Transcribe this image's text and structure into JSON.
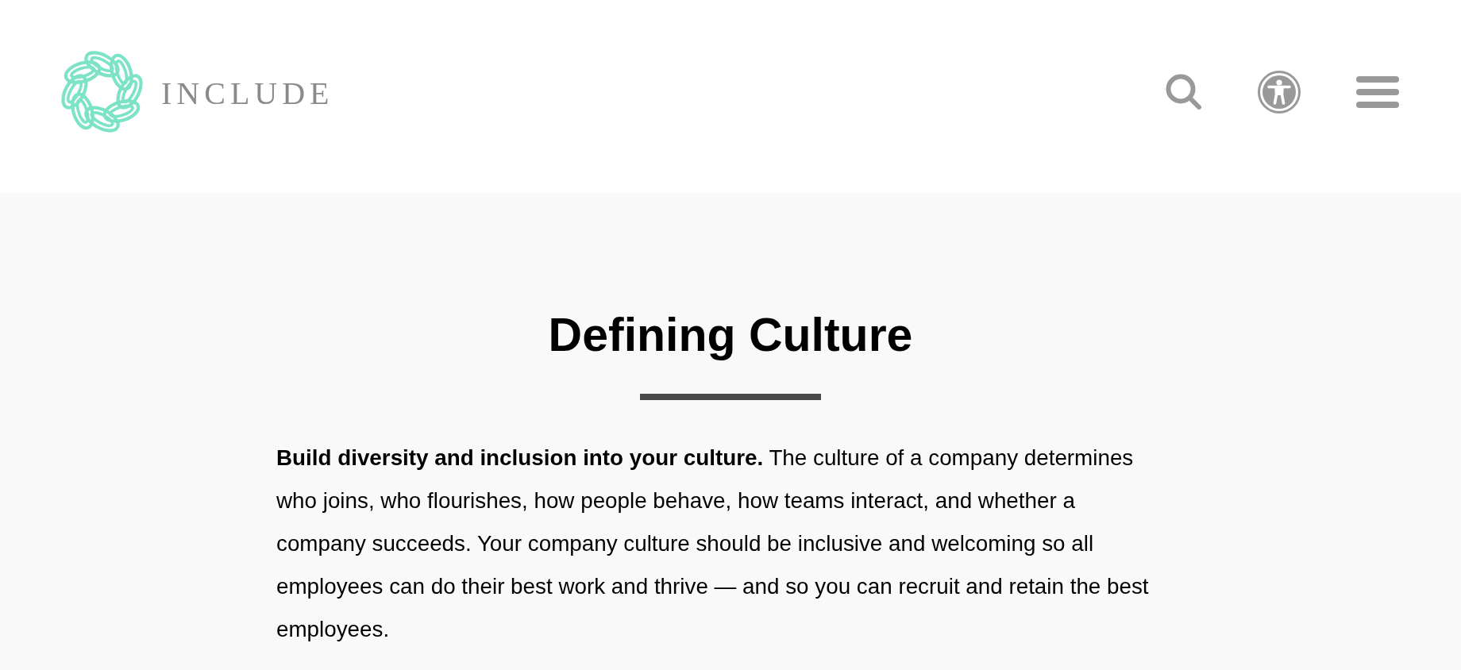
{
  "header": {
    "brand": "INCLUDE"
  },
  "section": {
    "title": "Defining Culture",
    "body": "**Build diversity and inclusion into your culture.** The culture of a company determines who joins, who flourishes, how people behave, how teams interact, and whether a company succeeds. Your company culture should be inclusive and welcoming so all employees can do their best work and thrive — and so you can recruit and retain the best employees."
  }
}
